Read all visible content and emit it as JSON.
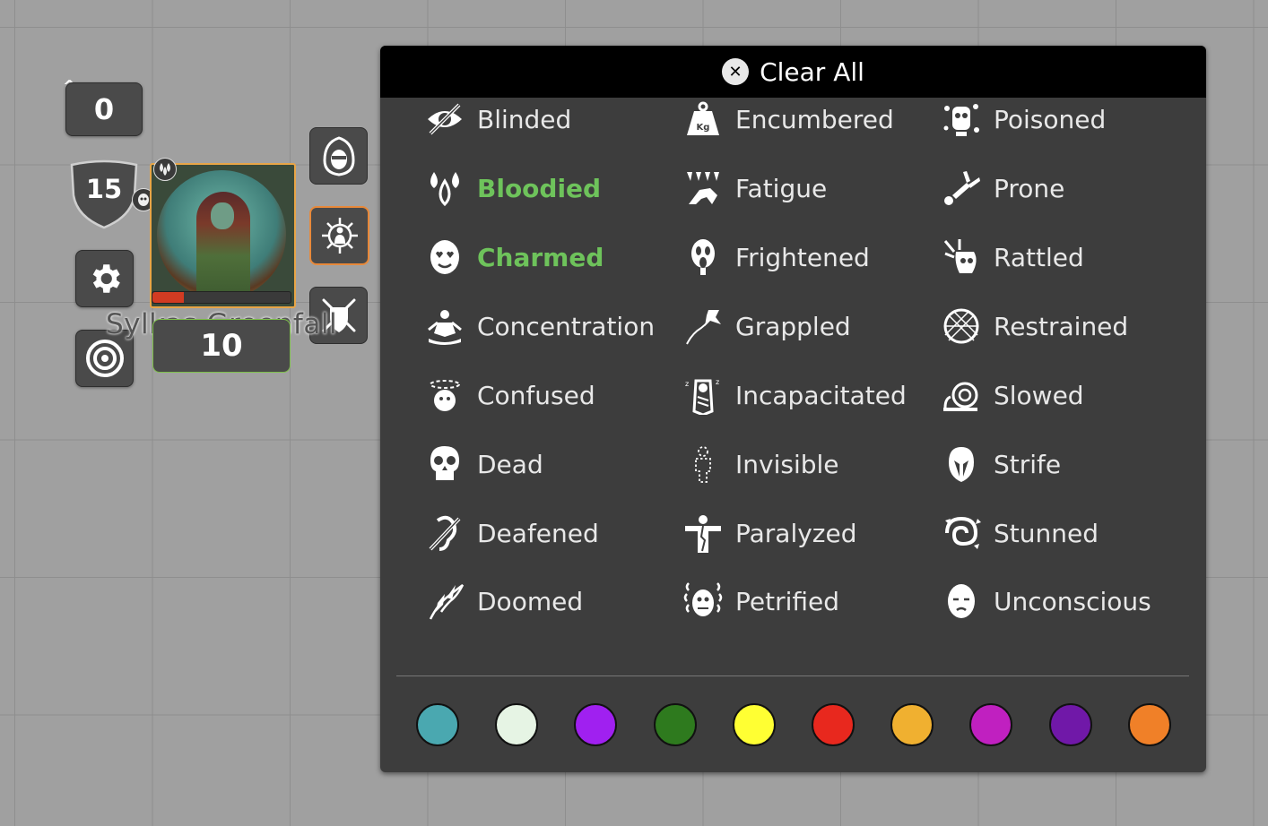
{
  "token": {
    "elevation": "0",
    "armor_class": "15",
    "name": "Sylkas Greenfall",
    "hp": "10",
    "hp_fraction": 0.23
  },
  "panel": {
    "clear_all": "Clear All",
    "statuses": [
      {
        "label": "Blinded",
        "icon": "blinded-icon",
        "active": false
      },
      {
        "label": "Encumbered",
        "icon": "encumbered-icon",
        "active": false
      },
      {
        "label": "Poisoned",
        "icon": "poisoned-icon",
        "active": false
      },
      {
        "label": "Bloodied",
        "icon": "bloodied-icon",
        "active": true
      },
      {
        "label": "Fatigue",
        "icon": "fatigue-icon",
        "active": false
      },
      {
        "label": "Prone",
        "icon": "prone-icon",
        "active": false
      },
      {
        "label": "Charmed",
        "icon": "charmed-icon",
        "active": true
      },
      {
        "label": "Frightened",
        "icon": "frightened-icon",
        "active": false
      },
      {
        "label": "Rattled",
        "icon": "rattled-icon",
        "active": false
      },
      {
        "label": "Concentration",
        "icon": "concentration-icon",
        "active": false
      },
      {
        "label": "Grappled",
        "icon": "grappled-icon",
        "active": false
      },
      {
        "label": "Restrained",
        "icon": "restrained-icon",
        "active": false
      },
      {
        "label": "Confused",
        "icon": "confused-icon",
        "active": false
      },
      {
        "label": "Incapacitated",
        "icon": "incapacitated-icon",
        "active": false
      },
      {
        "label": "Slowed",
        "icon": "slowed-icon",
        "active": false
      },
      {
        "label": "Dead",
        "icon": "dead-icon",
        "active": false
      },
      {
        "label": "Invisible",
        "icon": "invisible-icon",
        "active": false
      },
      {
        "label": "Strife",
        "icon": "strife-icon",
        "active": false
      },
      {
        "label": "Deafened",
        "icon": "deafened-icon",
        "active": false
      },
      {
        "label": "Paralyzed",
        "icon": "paralyzed-icon",
        "active": false
      },
      {
        "label": "Stunned",
        "icon": "stunned-icon",
        "active": false
      },
      {
        "label": "Doomed",
        "icon": "doomed-icon",
        "active": false
      },
      {
        "label": "Petrified",
        "icon": "petrified-icon",
        "active": false
      },
      {
        "label": "Unconscious",
        "icon": "unconscious-icon",
        "active": false
      }
    ],
    "colors": [
      "#4aa8b0",
      "#e6f4e4",
      "#a020f0",
      "#2e7a1e",
      "#ffff33",
      "#e8281e",
      "#f0b030",
      "#c020c0",
      "#7018a8",
      "#f08028"
    ]
  }
}
